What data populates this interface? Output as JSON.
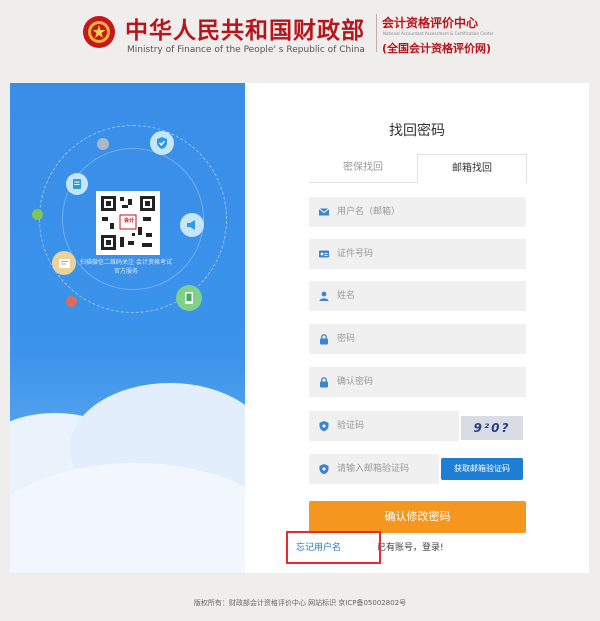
{
  "header": {
    "title_cn": "中华人民共和国财政部",
    "title_en": "Ministry of Finance of the People' s Republic of China",
    "center_name": "会计资格评价中心",
    "center_en": "National Accountant Assessment & Certification Center",
    "center_sub": "(全国会计资格评价网)"
  },
  "left_panel": {
    "qr_caption": "扫描微信二维码关注 会计资格考试官方服务",
    "qr_badge": "会计",
    "icons": [
      "shield-check-icon",
      "document-icon",
      "megaphone-icon",
      "certificate-icon",
      "mobile-phone-icon"
    ]
  },
  "form": {
    "title": "找回密码",
    "tabs": [
      {
        "label": "密保找回",
        "active": false
      },
      {
        "label": "邮箱找回",
        "active": true
      }
    ],
    "fields": {
      "username": {
        "placeholder": "用户名（邮箱）",
        "icon": "envelope-icon"
      },
      "id_number": {
        "placeholder": "证件号码",
        "icon": "id-card-icon"
      },
      "name": {
        "placeholder": "姓名",
        "icon": "user-icon"
      },
      "password": {
        "placeholder": "密码",
        "icon": "lock-icon"
      },
      "confirm_password": {
        "placeholder": "确认密码",
        "icon": "lock-icon"
      },
      "captcha": {
        "placeholder": "验证码",
        "icon": "shield-icon",
        "image_text": "9²0?"
      },
      "email_code": {
        "placeholder": "请输入邮箱验证码",
        "icon": "shield-icon"
      }
    },
    "get_code_label": "获取邮箱验证码",
    "submit_label": "确认修改密码",
    "forgot_username_label": "忘记用户名",
    "login_prompt": "已有账号，登录!"
  },
  "footer": {
    "text": "版权所有：财政部会计资格评价中心 网站标识 京ICP备05002802号"
  },
  "colors": {
    "brand_red": "#b8141b",
    "panel_blue": "#3b93ea",
    "button_orange": "#f5961f",
    "button_blue": "#1e7ed3",
    "highlight_red": "#e62b2b"
  }
}
